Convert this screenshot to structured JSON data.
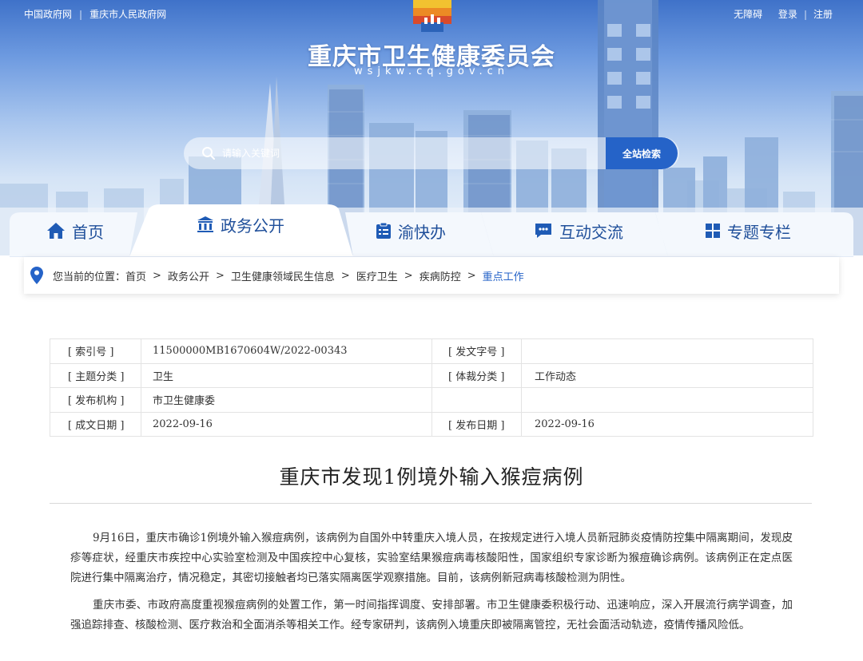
{
  "top_links": {
    "left1": "中国政府网",
    "left2": "重庆市人民政府网",
    "barrier_free": "无障碍",
    "login": "登录",
    "register": "注册"
  },
  "site": {
    "title": "重庆市卫生健康委员会",
    "domain": "wsjkw.cq.gov.cn"
  },
  "search": {
    "placeholder": "请输入关键词",
    "button": "全站检索"
  },
  "nav": {
    "home": "首页",
    "gov": "政务公开",
    "yu": "渝快办",
    "interact": "互动交流",
    "topics": "专题专栏"
  },
  "breadcrumb": {
    "prefix": "您当前的位置：",
    "items": [
      "首页",
      "政务公开",
      "卫生健康领域民生信息",
      "医疗卫生",
      "疾病防控"
    ],
    "current": "重点工作",
    "sep": ">"
  },
  "info": {
    "index_label": "[ 索引号 ]",
    "index_value": "11500000MB1670604W/2022-00343",
    "docno_label": "[ 发文字号 ]",
    "docno_value": "",
    "topic_label": "[ 主题分类 ]",
    "topic_value": "卫生",
    "genre_label": "[ 体裁分类 ]",
    "genre_value": "工作动态",
    "org_label": "[ 发布机构 ]",
    "org_value": "市卫生健康委",
    "made_label": "[ 成文日期 ]",
    "made_value": "2022-09-16",
    "pub_label": "[ 发布日期 ]",
    "pub_value": "2022-09-16"
  },
  "article": {
    "title": "重庆市发现1例境外输入猴痘病例",
    "p1": "9月16日，重庆市确诊1例境外输入猴痘病例，该病例为自国外中转重庆入境人员，在按规定进行入境人员新冠肺炎疫情防控集中隔离期间，发现皮疹等症状，经重庆市疾控中心实验室检测及中国疾控中心复核，实验室结果猴痘病毒核酸阳性，国家组织专家诊断为猴痘确诊病例。该病例正在定点医院进行集中隔离治疗，情况稳定，其密切接触者均已落实隔离医学观察措施。目前，该病例新冠病毒核酸检测为阴性。",
    "p2": "重庆市委、市政府高度重视猴痘病例的处置工作，第一时间指挥调度、安排部署。市卫生健康委积极行动、迅速响应，深入开展流行病学调查，加强追踪排查、核酸检测、医疗救治和全面消杀等相关工作。经专家研判，该病例入境重庆即被隔离管控，无社会面活动轨迹，疫情传播风险低。"
  },
  "colors": {
    "nav_text": "#1f4f9a",
    "accent": "#2563c8",
    "banner_top": "#3f72c9"
  },
  "icons": {
    "home": "home-icon",
    "gov": "building-icon",
    "yu": "clipboard-icon",
    "interact": "chat-icon",
    "topics": "grid-icon",
    "location": "location-pin-icon",
    "search": "search-icon"
  }
}
